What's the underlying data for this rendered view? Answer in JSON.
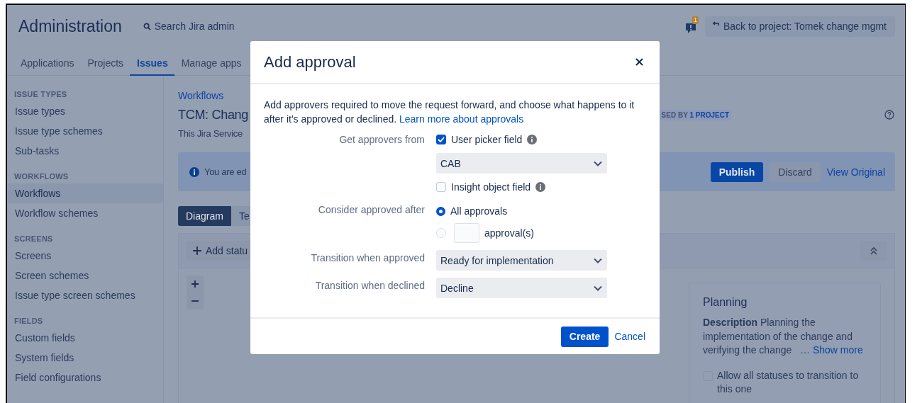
{
  "header": {
    "title": "Administration",
    "search": "Search Jira admin",
    "notification_count": "1",
    "back_button": "Back to project: Tomek change mgmt"
  },
  "nav_tabs": [
    {
      "label": "Applications",
      "selected": false
    },
    {
      "label": "Projects",
      "selected": false
    },
    {
      "label": "Issues",
      "selected": true
    },
    {
      "label": "Manage apps",
      "selected": false
    }
  ],
  "sidebar": [
    {
      "heading": "ISSUE TYPES",
      "items": [
        {
          "label": "Issue types",
          "selected": false
        },
        {
          "label": "Issue type schemes",
          "selected": false
        },
        {
          "label": "Sub-tasks",
          "selected": false
        }
      ]
    },
    {
      "heading": "WORKFLOWS",
      "items": [
        {
          "label": "Workflows",
          "selected": true
        },
        {
          "label": "Workflow schemes",
          "selected": false
        }
      ]
    },
    {
      "heading": "SCREENS",
      "items": [
        {
          "label": "Screens",
          "selected": false
        },
        {
          "label": "Screen schemes",
          "selected": false
        },
        {
          "label": "Issue type screen schemes",
          "selected": false
        }
      ]
    },
    {
      "heading": "FIELDS",
      "items": [
        {
          "label": "Custom fields",
          "selected": false
        },
        {
          "label": "System fields",
          "selected": false
        },
        {
          "label": "Field configurations",
          "selected": false
        }
      ]
    }
  ],
  "main": {
    "breadcrumb": "Workflows",
    "title": "TCM: Chang",
    "badge": {
      "label": "SED BY",
      "count": "1 PROJECT"
    },
    "description": "This Jira Service",
    "banner": {
      "text": "You are ed",
      "buttons": [
        {
          "label": "Publish",
          "kind": "primary"
        },
        {
          "label": "Discard",
          "kind": "subtle"
        },
        {
          "label": "View Original",
          "kind": "link"
        }
      ]
    },
    "view_tabs": [
      {
        "label": "Diagram",
        "selected": true
      },
      {
        "label": "Te",
        "selected": false
      }
    ],
    "add_status": "Add statu",
    "status_card": {
      "title": "Planning",
      "description": "**Description** Planning the implementation of the change and verifying the change",
      "ellipsis": "…",
      "show_more": "Show more",
      "allow_all": {
        "label": "Allow all statuses to transition to this one",
        "checked": false
      }
    }
  },
  "dialog": {
    "title": "Add approval",
    "intro": "Add approvers required to move the request forward, and choose what happens to it after it's approved or declined.",
    "intro_link": "Learn more about approvals",
    "approvers_label": "Get approvers from",
    "sources": [
      {
        "label": "User picker field",
        "checked": true,
        "value": "CAB"
      },
      {
        "label": "Insight object field",
        "checked": false
      }
    ],
    "consider_label": "Consider approved after",
    "options": [
      {
        "kind": "all",
        "label": "All approvals",
        "selected": true
      },
      {
        "kind": "count",
        "label": "approval(s)",
        "selected": false
      }
    ],
    "transitions": [
      {
        "label": "Transition when approved",
        "value": "Ready for implementation"
      },
      {
        "label": "Transition when declined",
        "value": "Decline"
      }
    ],
    "buttons": [
      {
        "label": "Create",
        "kind": "primary"
      },
      {
        "label": "Cancel",
        "kind": "link"
      }
    ]
  }
}
